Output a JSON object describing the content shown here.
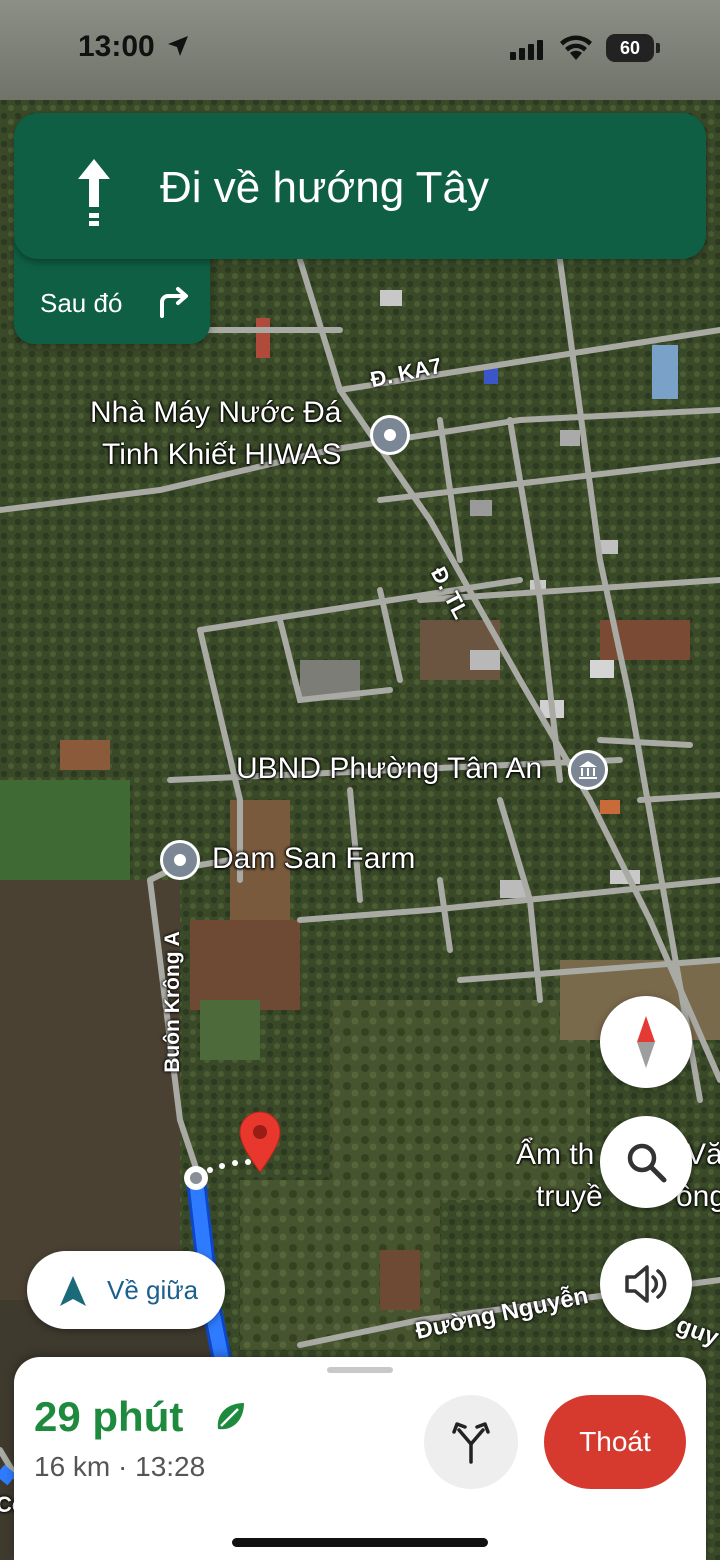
{
  "status_bar": {
    "time": "13:00",
    "battery": "60"
  },
  "banner": {
    "instruction": "Đi về hướng Tây",
    "then_label": "Sau đó"
  },
  "map": {
    "places": {
      "hiwas_line1": "Nhà Máy Nước Đá",
      "hiwas_line2": "Tinh Khiết HIWAS",
      "ubnd": "UBND Phường Tân An",
      "dam_san": "Dam San Farm",
      "am_thuc_line1": "Ẩm th",
      "am_thuc_line1b": "Văn",
      "am_thuc_line2": "truyề",
      "am_thuc_line2b": "ông"
    },
    "roads": {
      "ka7": "Đ. KA7",
      "tl": "Đ. TL",
      "buon_krong": "Buôn Krông A",
      "nguyen": "Đường Nguyễn",
      "nguyen_partial": "guy",
      "edge": "Co"
    }
  },
  "controls": {
    "recenter_label": "Về giữa",
    "compass": "compass-icon",
    "search": "search-icon",
    "sound": "speaker-icon"
  },
  "trip": {
    "duration": "29 phút",
    "distance_time": "16 km · 13:28",
    "exit_label": "Thoát"
  },
  "colors": {
    "banner": "#0f5f45",
    "route": "#1a73e8",
    "eta_green": "#1e8a3e",
    "exit_red": "#d63a2f",
    "destination_pin": "#e8372c"
  }
}
